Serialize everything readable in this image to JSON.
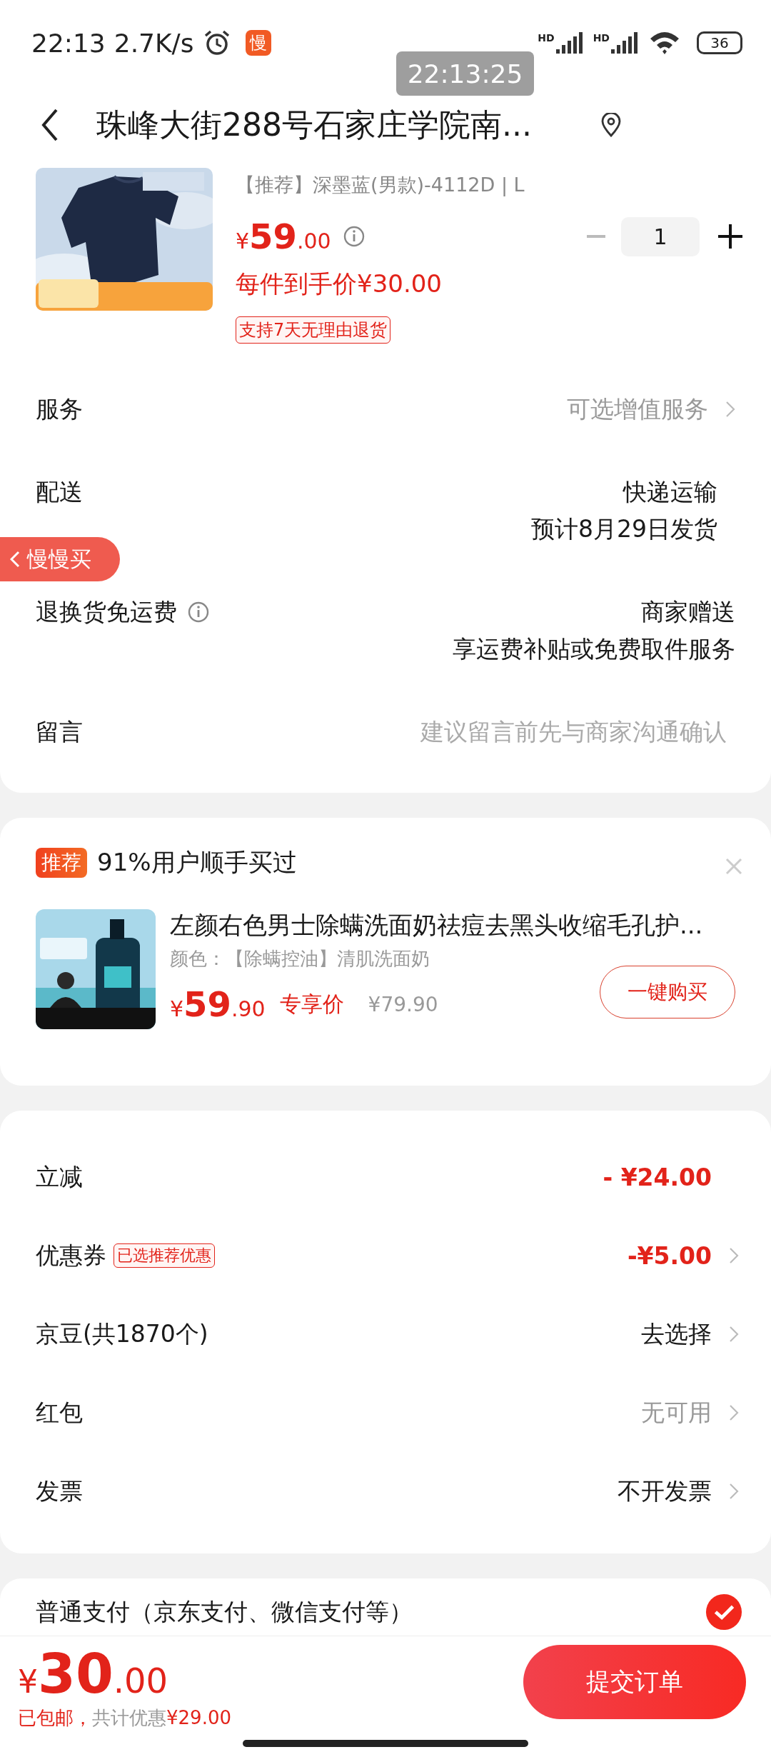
{
  "status_bar": {
    "time": "22:13",
    "speed": "2.7K/s",
    "app_badge": "慢",
    "signals": [
      "HD",
      "HD"
    ],
    "battery": "36"
  },
  "recorder_overlay": {
    "time": "22:13:25"
  },
  "header": {
    "address": "珠峰大街288号石家庄学院南..."
  },
  "product": {
    "spec": "【推荐】深墨蓝(男款)-4112D | L",
    "price_symbol": "¥",
    "price_int": "59",
    "price_dec": ".00",
    "quantity": "1",
    "final_price": "每件到手价¥30.00",
    "tag": "支持7天无理由退货"
  },
  "order_rows": [
    {
      "kind": "option",
      "label": "服务",
      "lines": [
        "可选增值服务"
      ]
    },
    {
      "kind": "delivery",
      "label": "配送",
      "lines": [
        "快递运输",
        "预计8月29日发货"
      ]
    },
    {
      "kind": "info",
      "label": "退换货免运费",
      "lines": [
        "商家赠送",
        "享运费补贴或免费取件服务"
      ]
    },
    {
      "kind": "note",
      "label": "留言",
      "placeholder": "建议留言前先与商家沟通确认"
    }
  ],
  "floating_badge": {
    "label": "慢慢买"
  },
  "recommendation": {
    "badge": "推荐",
    "title": "91%用户顺手买过",
    "item": {
      "name": "左颜右色男士除螨洗面奶祛痘去黑头收缩毛孔护...",
      "spec": "颜色：【除螨控油】清肌洗面奶",
      "price_symbol": "¥",
      "price_int": "59",
      "price_dec": ".90",
      "price_label": "专享价",
      "original_price": "¥79.90",
      "button": "一键购买"
    }
  },
  "discounts": [
    {
      "kind": "amount",
      "label": "立减",
      "value": "- ¥24.00"
    },
    {
      "kind": "amount_link",
      "label": "优惠券",
      "tag": "已选推荐优惠",
      "value": "-¥5.00"
    },
    {
      "kind": "link",
      "label": "京豆(共1870个)",
      "value": "去选择"
    },
    {
      "kind": "muted_link",
      "label": "红包",
      "value": "无可用"
    },
    {
      "kind": "link",
      "label": "发票",
      "value": "不开发票"
    }
  ],
  "payment": {
    "label": "普通支付（京东支付、微信支付等）",
    "selected": true
  },
  "bottom_bar": {
    "price_symbol": "¥",
    "price_int": "30",
    "price_dec": ".00",
    "shipping": "已包邮，",
    "savings_label": "共计优惠",
    "savings": "¥29.00",
    "submit": "提交订单"
  }
}
